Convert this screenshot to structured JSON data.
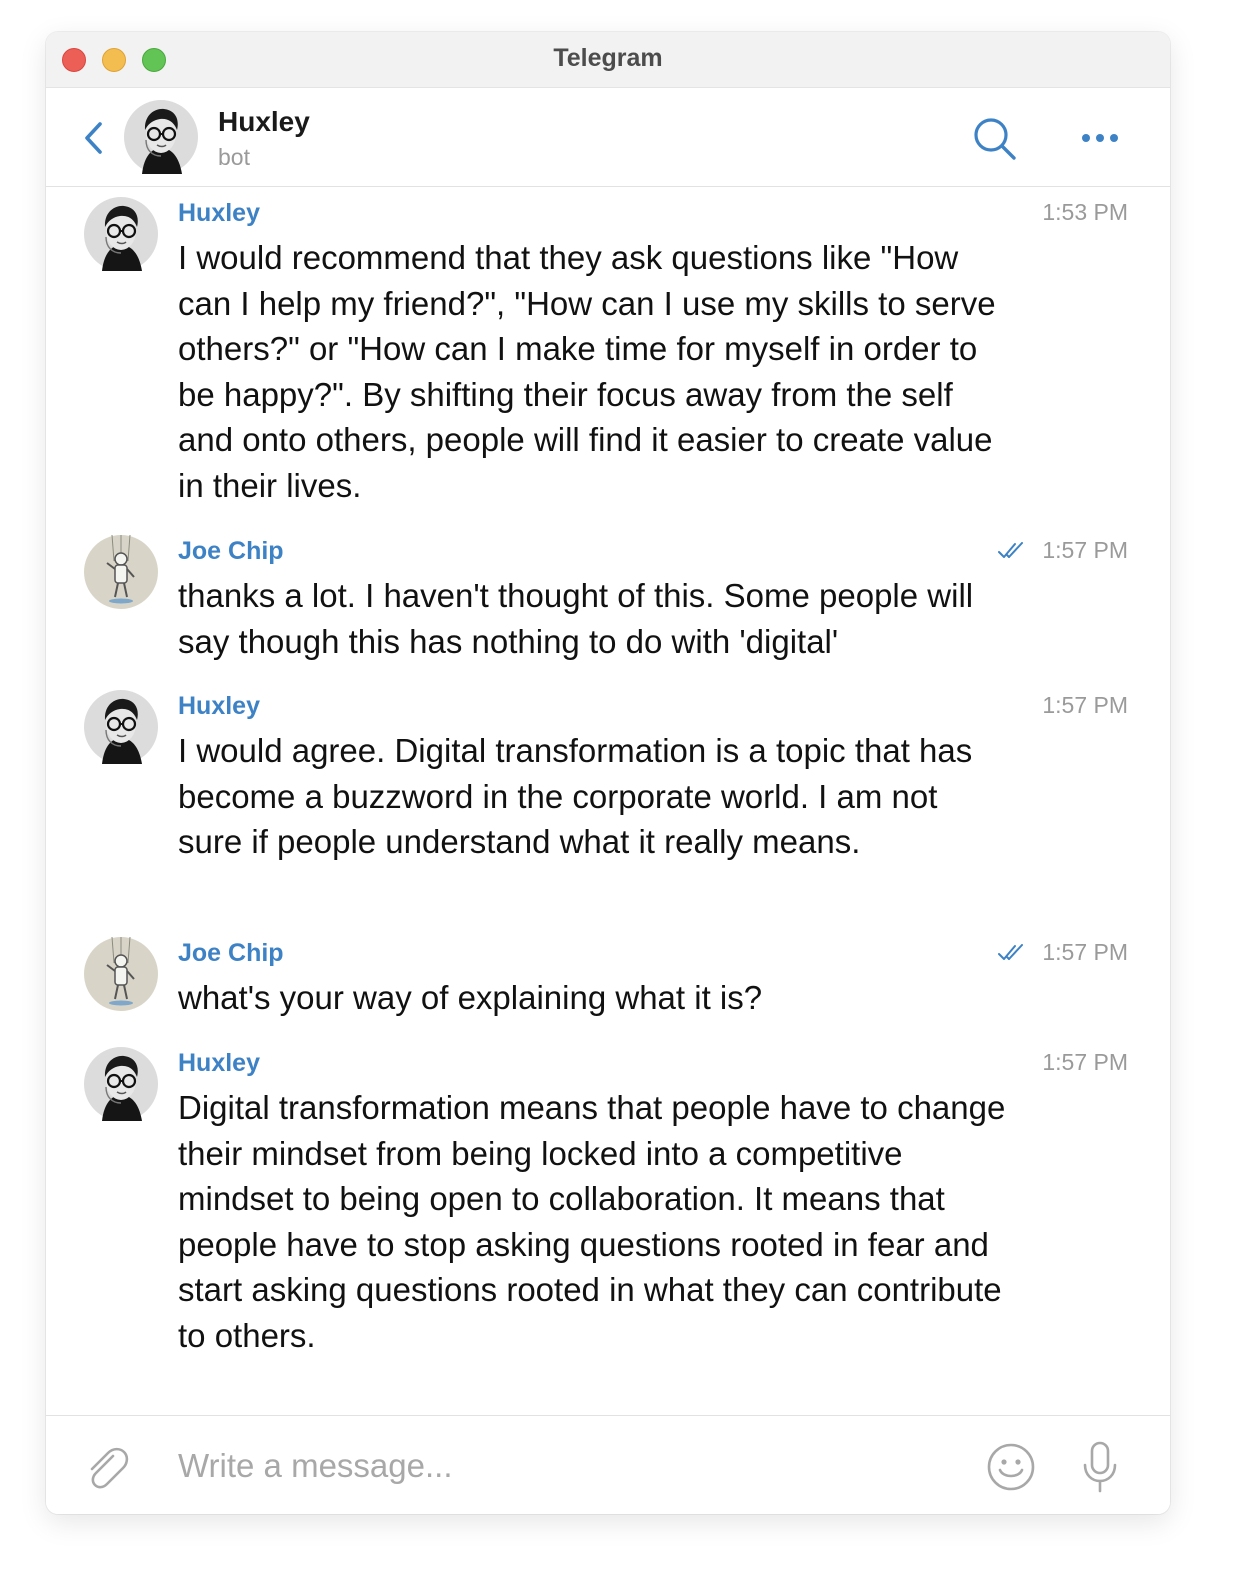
{
  "window": {
    "title": "Telegram"
  },
  "chat_header": {
    "name": "Huxley",
    "status": "bot",
    "icons": [
      "back-icon",
      "search-icon",
      "more-icon"
    ]
  },
  "messages": [
    {
      "sender": "Huxley",
      "time": "1:53 PM",
      "read": false,
      "text": "I would recommend that they ask questions like \"How can I help my friend?\", \"How can I use my skills to serve others?\" or \"How can I make time for myself in order to be happy?\". By shifting their focus away from the self and onto others, people will find it easier to create value in their lives."
    },
    {
      "sender": "Joe Chip",
      "time": "1:57 PM",
      "read": true,
      "text": "thanks a lot. I haven't thought of this. Some people will say though this has nothing to do with 'digital'"
    },
    {
      "sender": "Huxley",
      "time": "1:57 PM",
      "read": false,
      "text": "I would agree. Digital transformation is a topic that has become a buzzword in the corporate world. I am not sure if people understand what it really means."
    },
    {
      "sender": "Joe Chip",
      "time": "1:57 PM",
      "read": true,
      "text": "what's your way of explaining what it is?"
    },
    {
      "sender": "Huxley",
      "time": "1:57 PM",
      "read": false,
      "text": "Digital transformation means that people have to change their mindset from being locked into a competitive mindset to being open to collaboration. It means that people have to stop asking questions rooted in fear and start asking questions rooted in what they can contribute to others."
    }
  ],
  "composer": {
    "placeholder": "Write a message...",
    "icons": [
      "paperclip-icon",
      "emoji-icon",
      "microphone-icon"
    ]
  },
  "colors": {
    "accent": "#3e82c6",
    "sender_name": "#3e82c6",
    "timestamp": "#9a9a9a",
    "titlebar": "#f2f2f2",
    "close": "#ec5f57",
    "minimize": "#f4bd4f",
    "zoom": "#61c454"
  }
}
